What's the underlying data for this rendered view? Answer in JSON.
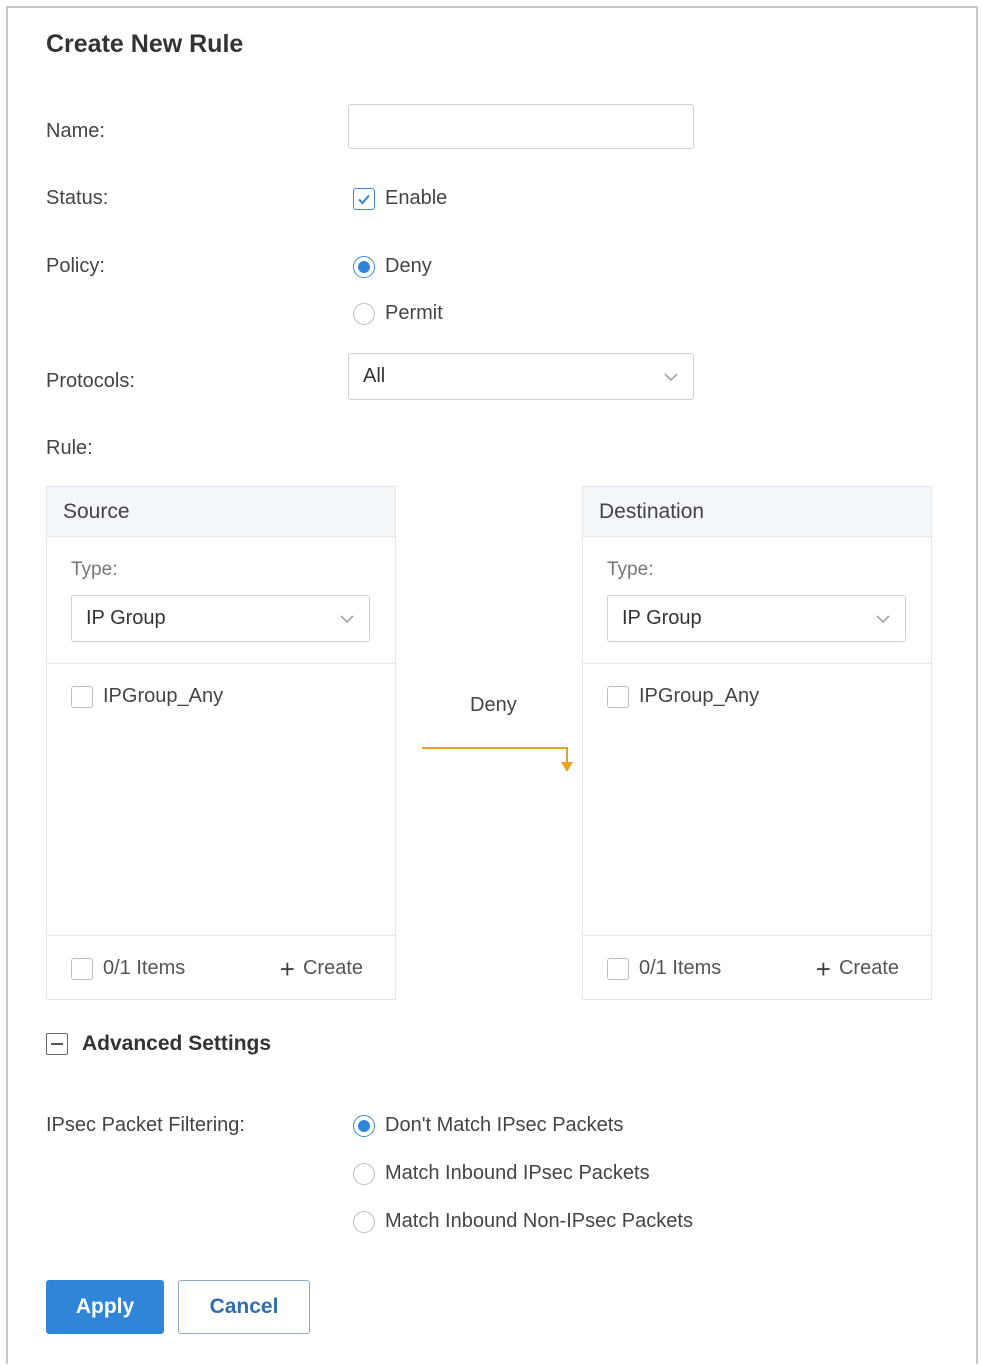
{
  "dialog": {
    "title": "Create New Rule"
  },
  "form": {
    "name_label": "Name:",
    "name_value": "",
    "status_label": "Status:",
    "status_enable": "Enable",
    "policy_label": "Policy:",
    "policy_options": [
      "Deny",
      "Permit"
    ],
    "policy_selected": "Deny",
    "protocols_label": "Protocols:",
    "protocols_value": "All",
    "rule_label": "Rule:"
  },
  "rule": {
    "source": {
      "title": "Source",
      "type_label": "Type:",
      "type_value": "IP Group",
      "items": [
        "IPGroup_Any"
      ],
      "count": "0/1 Items",
      "create": "Create"
    },
    "action": "Deny",
    "destination": {
      "title": "Destination",
      "type_label": "Type:",
      "type_value": "IP Group",
      "items": [
        "IPGroup_Any"
      ],
      "count": "0/1 Items",
      "create": "Create"
    }
  },
  "advanced": {
    "title": "Advanced Settings",
    "ipsec_label": "IPsec Packet Filtering:",
    "ipsec_options": [
      "Don't Match IPsec Packets",
      "Match Inbound IPsec Packets",
      "Match Inbound Non-IPsec Packets"
    ],
    "ipsec_selected": "Don't Match IPsec Packets"
  },
  "buttons": {
    "apply": "Apply",
    "cancel": "Cancel"
  },
  "colors": {
    "accent": "#2f86d9",
    "arrow": "#e8a324",
    "panel_header": "#f3f6fa"
  }
}
